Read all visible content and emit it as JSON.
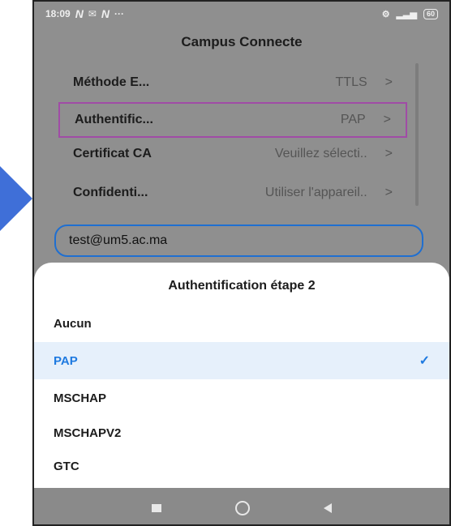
{
  "status_bar": {
    "time": "18:09",
    "dots": "···",
    "battery": "60"
  },
  "header": {
    "title": "Campus Connecte"
  },
  "settings": [
    {
      "label": "Méthode E...",
      "value": "TTLS",
      "chevron": ">"
    },
    {
      "label": "Authentific...",
      "value": "PAP",
      "chevron": ">"
    },
    {
      "label": "Certificat CA",
      "value": "Veuillez sélecti..",
      "chevron": ">"
    },
    {
      "label": "Confidenti...",
      "value": "Utiliser l'appareil..",
      "chevron": ">"
    }
  ],
  "identity_field": {
    "value": "test@um5.ac.ma"
  },
  "sheet": {
    "title": "Authentification étape 2",
    "options": [
      {
        "label": "Aucun",
        "selected": false
      },
      {
        "label": "PAP",
        "selected": true
      },
      {
        "label": "MSCHAP",
        "selected": false
      },
      {
        "label": "MSCHAPV2",
        "selected": false
      },
      {
        "label": "GTC",
        "selected": false
      }
    ],
    "check_glyph": "✓"
  },
  "colors": {
    "accent": "#1f7ae0",
    "highlight_border": "#a04ca6",
    "arrow": "#3f6fd8"
  },
  "icons": [
    "arrow-right-icon",
    "wifi-icon",
    "signal-icon",
    "battery-icon",
    "check-icon",
    "nav-recents-icon",
    "nav-home-icon",
    "nav-back-icon"
  ]
}
